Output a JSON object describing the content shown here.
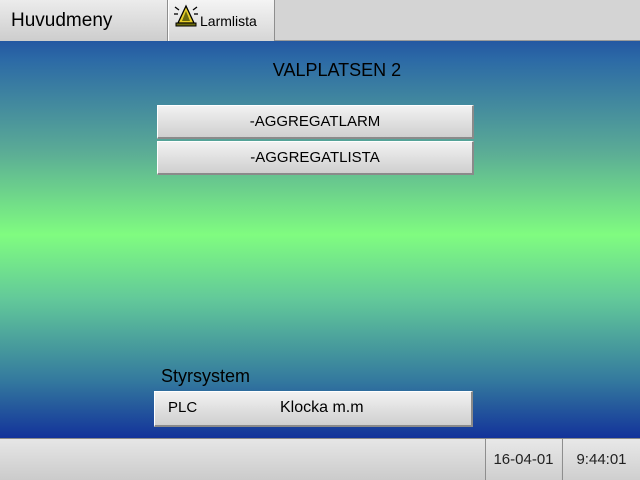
{
  "header": {
    "menu_title": "Huvudmeny",
    "alarm_button_label": "Larmlista",
    "alarm_icon": "alarm-bell-icon"
  },
  "main": {
    "title": "VALPLATSEN 2",
    "buttons": [
      {
        "label": "-AGGREGATLARM"
      },
      {
        "label": "-AGGREGATLISTA"
      }
    ]
  },
  "styrsystem": {
    "label": "Styrsystem",
    "plc_label": "PLC",
    "clock_label": "Klocka m.m"
  },
  "status": {
    "date": "16-04-01",
    "time": "9:44:01"
  },
  "colors": {
    "background_top": "#12309a",
    "background_mid": "#80fc80",
    "button_face": "#dcdcdc"
  }
}
